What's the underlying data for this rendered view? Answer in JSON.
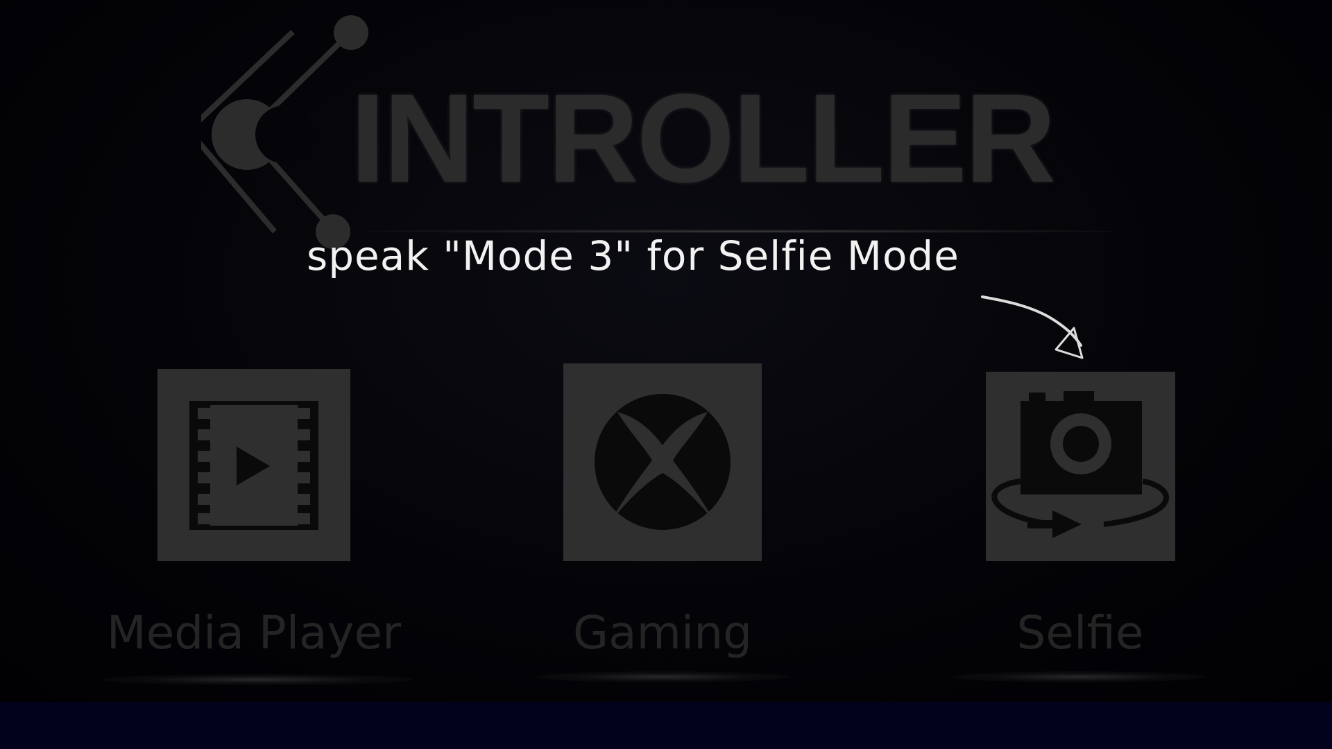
{
  "app": {
    "logo_text": "INTROLLER"
  },
  "hint": {
    "text": "speak \"Mode 3\" for Selfie Mode",
    "target_mode": "Selfie"
  },
  "modes": [
    {
      "label": "Media Player",
      "icon": "film-play-icon"
    },
    {
      "label": "Gaming",
      "icon": "xbox-icon"
    },
    {
      "label": "Selfie",
      "icon": "camera-rotate-icon"
    }
  ],
  "colors": {
    "background": "#020208",
    "tile": "#2f2f2f",
    "logo": "#2b2b2b",
    "hint_text": "#f2f2f2",
    "bottom_bar": "#02021c"
  }
}
